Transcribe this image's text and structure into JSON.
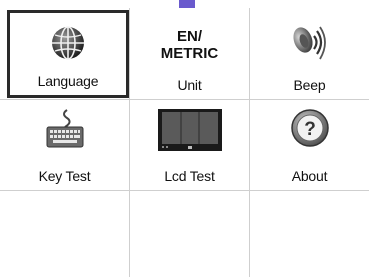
{
  "menu": {
    "items": [
      {
        "label": "Language",
        "icon": "globe-icon"
      },
      {
        "label": "Unit",
        "icon": "unit-icon",
        "icon_text_1": "EN/",
        "icon_text_2": "METRIC"
      },
      {
        "label": "Beep",
        "icon": "speaker-icon"
      },
      {
        "label": "Key Test",
        "icon": "keyboard-icon"
      },
      {
        "label": "Lcd Test",
        "icon": "lcd-icon"
      },
      {
        "label": "About",
        "icon": "question-icon"
      }
    ],
    "selected": "Language"
  },
  "colors": {
    "accent": "#6a5acd",
    "grid_line": "#cfcfcf",
    "selection_border": "#2a2a2a"
  }
}
